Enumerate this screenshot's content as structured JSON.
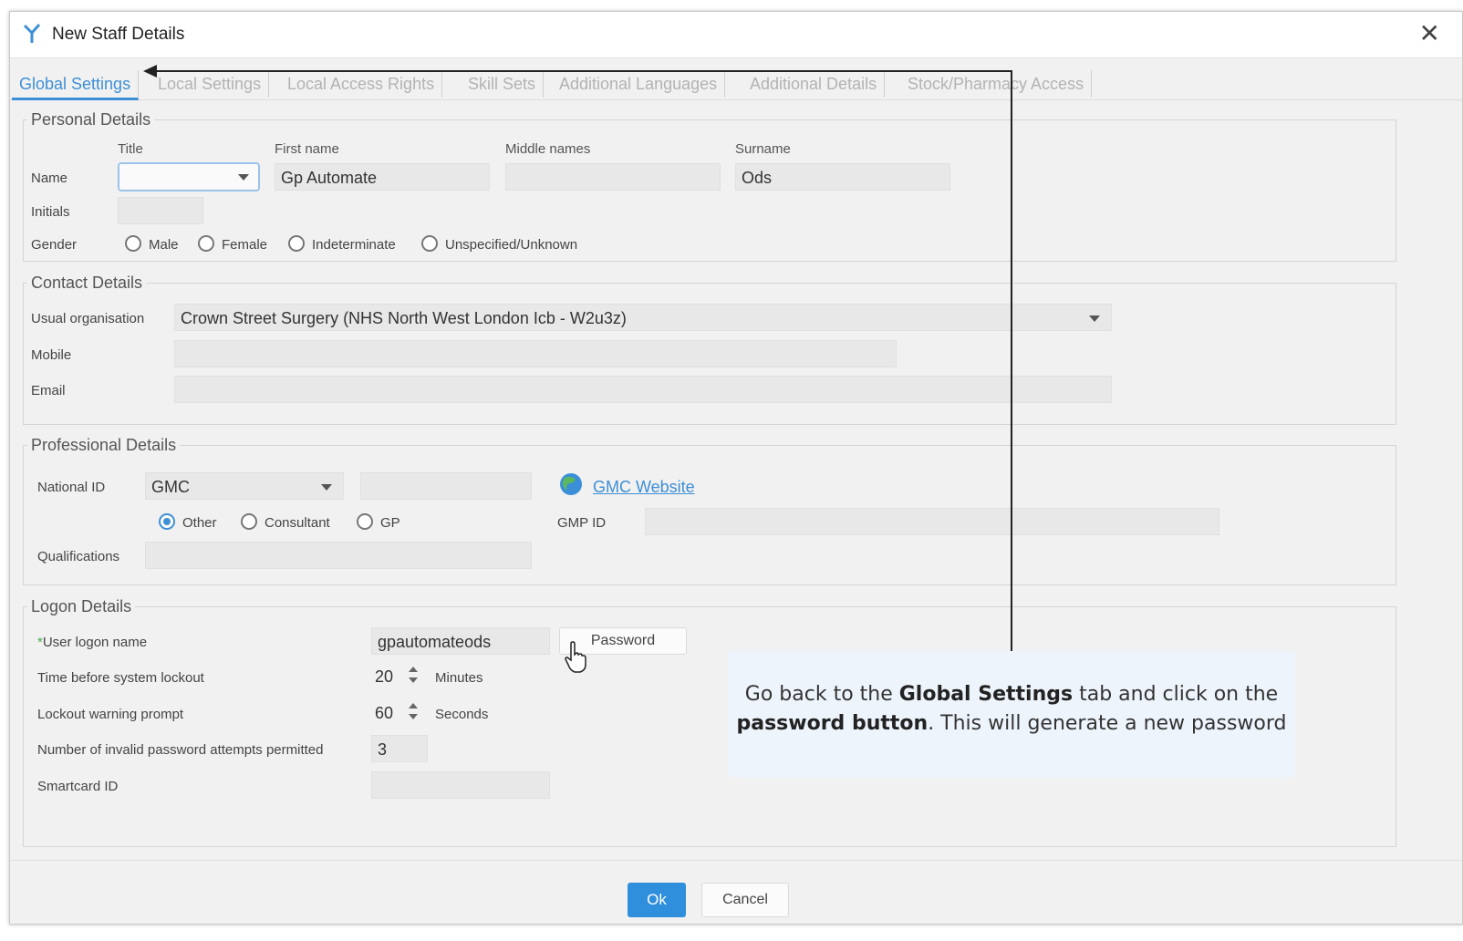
{
  "window": {
    "title": "New Staff Details",
    "close_symbol": "✕"
  },
  "tabs": [
    {
      "label": "Global Settings",
      "active": true
    },
    {
      "label": "Local Settings"
    },
    {
      "label": "Local Access Rights"
    },
    {
      "label": "Skill Sets"
    },
    {
      "label": "Additional Languages"
    },
    {
      "label": "Additional Details"
    },
    {
      "label": "Stock/Pharmacy Access"
    }
  ],
  "personal": {
    "legend": "Personal Details",
    "hdr_title": "Title",
    "hdr_first": "First name",
    "hdr_middle": "Middle names",
    "hdr_surname": "Surname",
    "name_label": "Name",
    "title_value": "",
    "first_name": "Gp Automate",
    "middle_names": "",
    "surname": "Ods",
    "initials_label": "Initials",
    "initials": "",
    "gender_label": "Gender",
    "gender_options": [
      "Male",
      "Female",
      "Indeterminate",
      "Unspecified/Unknown"
    ]
  },
  "contact": {
    "legend": "Contact Details",
    "org_label": "Usual organisation",
    "org_value": "Crown Street Surgery (NHS North West London Icb - W2u3z)",
    "mobile_label": "Mobile",
    "mobile": "",
    "email_label": "Email",
    "email": ""
  },
  "professional": {
    "legend": "Professional Details",
    "national_id_label": "National ID",
    "national_id_type": "GMC",
    "national_id_value": "",
    "gmc_link": "GMC Website",
    "role_options": [
      "Other",
      "Consultant",
      "GP"
    ],
    "role_selected": "Other",
    "gmp_label": "GMP ID",
    "gmp_value": "",
    "qualifications_label": "Qualifications",
    "qualifications": ""
  },
  "logon": {
    "legend": "Logon Details",
    "required_marker": "*",
    "user_logon_label": "User logon name",
    "user_logon": "gpautomateods",
    "password_button": "Password",
    "lockout_label": "Time before system lockout",
    "lockout_value": "20",
    "lockout_unit": "Minutes",
    "warning_label": "Lockout warning prompt",
    "warning_value": "60",
    "warning_unit": "Seconds",
    "invalid_label": "Number of invalid password attempts permitted",
    "invalid_value": "3",
    "smartcard_label": "Smartcard ID",
    "smartcard": ""
  },
  "footer": {
    "ok": "Ok",
    "cancel": "Cancel"
  },
  "callout": {
    "part1": "Go back to the ",
    "bold1": "Global Settings",
    "part2": " tab and click on the ",
    "bold2": "password button",
    "part3": ". This will generate a new password"
  },
  "colors": {
    "accent": "#3d8fd6",
    "ok_button": "#2f8fdc",
    "callout_bg": "#eef4fc"
  }
}
